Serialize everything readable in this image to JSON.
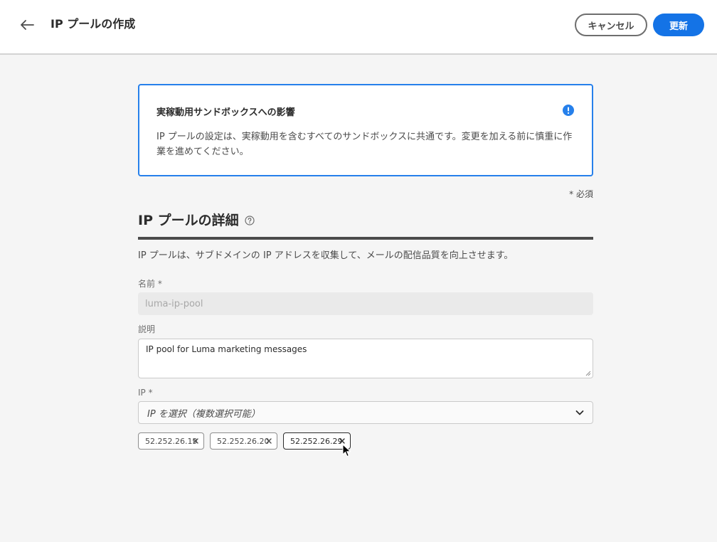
{
  "header": {
    "title": "IP プールの作成",
    "cancel_label": "キャンセル",
    "update_label": "更新"
  },
  "alert": {
    "title": "実稼動用サンドボックスへの影響",
    "body": "IP プールの設定は、実稼動用を含むすべてのサンドボックスに共通です。変更を加える前に慎重に作業を進めてください。",
    "accent_color": "#2680eb"
  },
  "form": {
    "required_note": "* 必須",
    "section_title": "IP プールの詳細",
    "section_desc": "IP プールは、サブドメインの IP アドレスを収集して、メールの配信品質を向上させます。",
    "name_label": "名前 *",
    "name_value": "luma-ip-pool",
    "desc_label": "説明",
    "desc_value": "IP pool for Luma marketing messages",
    "ip_label": "IP *",
    "ip_placeholder": "IP を選択（複数選択可能）",
    "selected_ips": [
      "52.252.26.19",
      "52.252.26.20",
      "52.252.26.29"
    ]
  },
  "colors": {
    "primary": "#1473e6",
    "background": "#f5f5f5"
  },
  "icons": {
    "back": "arrow-left-icon",
    "alert": "info-circle-icon",
    "help": "help-circle-icon",
    "dropdown": "chevron-down-icon",
    "remove": "close-icon"
  }
}
